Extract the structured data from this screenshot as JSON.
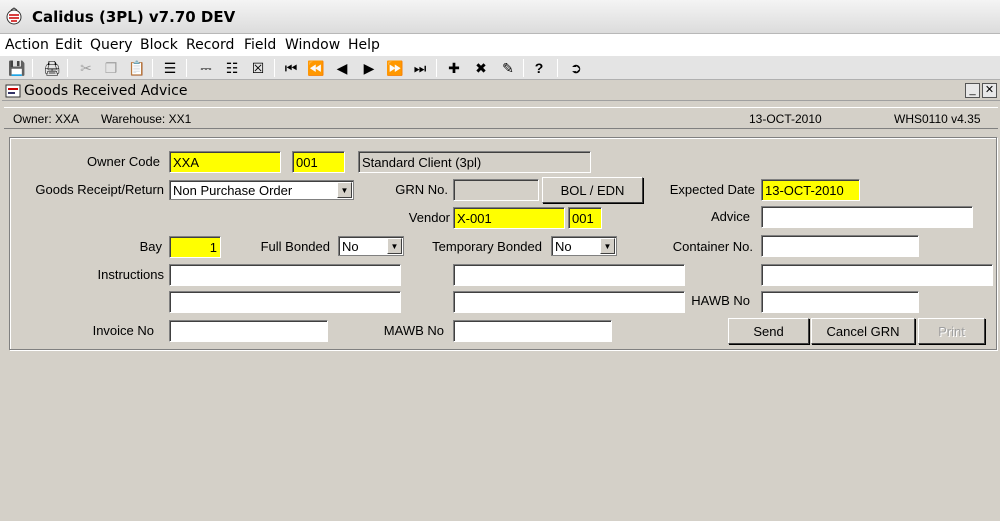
{
  "app": {
    "title": "Calidus (3PL) v7.70 DEV"
  },
  "menu": [
    "Action",
    "Edit",
    "Query",
    "Block",
    "Record",
    "Field",
    "Window",
    "Help"
  ],
  "window": {
    "title": "Goods Received Advice"
  },
  "info": {
    "owner": "Owner:  XXA",
    "warehouse": "Warehouse:  XX1",
    "date": "13-OCT-2010",
    "version": "WHS0110  v4.35"
  },
  "form": {
    "owner_code_label": "Owner Code",
    "owner_code": "XXA",
    "owner_sub": "001",
    "owner_desc": "Standard Client (3pl)",
    "receipt_label": "Goods Receipt/Return",
    "receipt_value": "Non Purchase Order",
    "grn_label": "GRN No.",
    "grn_value": "",
    "bol_button": "BOL / EDN",
    "expected_label": "Expected Date",
    "expected_value": "13-OCT-2010",
    "vendor_label": "Vendor",
    "vendor_value": "X-001",
    "vendor_sub": "001",
    "advice_label": "Advice",
    "advice_value": "",
    "bay_label": "Bay",
    "bay_value": "1",
    "full_bonded_label": "Full Bonded",
    "full_bonded_value": "No",
    "temp_bonded_label": "Temporary Bonded",
    "temp_bonded_value": "No",
    "container_label": "Container No.",
    "container_value": "",
    "instructions_label": "Instructions",
    "hawb_label": "HAWB No",
    "hawb_value": "",
    "invoice_label": "Invoice No",
    "invoice_value": "",
    "mawb_label": "MAWB No",
    "mawb_value": "",
    "send_button": "Send",
    "cancel_button": "Cancel GRN",
    "print_button": "Print"
  }
}
